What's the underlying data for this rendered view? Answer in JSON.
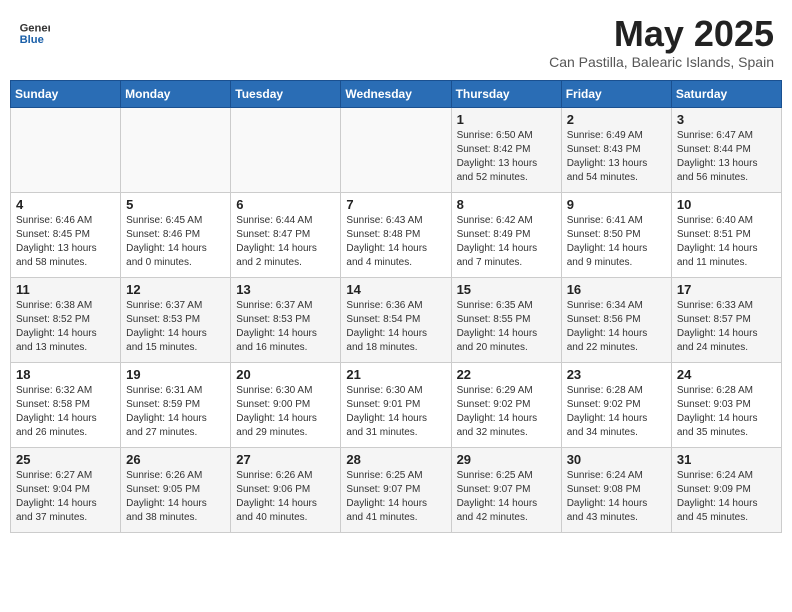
{
  "header": {
    "logo_general": "General",
    "logo_blue": "Blue",
    "month_title": "May 2025",
    "location": "Can Pastilla, Balearic Islands, Spain"
  },
  "days_of_week": [
    "Sunday",
    "Monday",
    "Tuesday",
    "Wednesday",
    "Thursday",
    "Friday",
    "Saturday"
  ],
  "weeks": [
    [
      {
        "num": "",
        "info": ""
      },
      {
        "num": "",
        "info": ""
      },
      {
        "num": "",
        "info": ""
      },
      {
        "num": "",
        "info": ""
      },
      {
        "num": "1",
        "info": "Sunrise: 6:50 AM\nSunset: 8:42 PM\nDaylight: 13 hours\nand 52 minutes."
      },
      {
        "num": "2",
        "info": "Sunrise: 6:49 AM\nSunset: 8:43 PM\nDaylight: 13 hours\nand 54 minutes."
      },
      {
        "num": "3",
        "info": "Sunrise: 6:47 AM\nSunset: 8:44 PM\nDaylight: 13 hours\nand 56 minutes."
      }
    ],
    [
      {
        "num": "4",
        "info": "Sunrise: 6:46 AM\nSunset: 8:45 PM\nDaylight: 13 hours\nand 58 minutes."
      },
      {
        "num": "5",
        "info": "Sunrise: 6:45 AM\nSunset: 8:46 PM\nDaylight: 14 hours\nand 0 minutes."
      },
      {
        "num": "6",
        "info": "Sunrise: 6:44 AM\nSunset: 8:47 PM\nDaylight: 14 hours\nand 2 minutes."
      },
      {
        "num": "7",
        "info": "Sunrise: 6:43 AM\nSunset: 8:48 PM\nDaylight: 14 hours\nand 4 minutes."
      },
      {
        "num": "8",
        "info": "Sunrise: 6:42 AM\nSunset: 8:49 PM\nDaylight: 14 hours\nand 7 minutes."
      },
      {
        "num": "9",
        "info": "Sunrise: 6:41 AM\nSunset: 8:50 PM\nDaylight: 14 hours\nand 9 minutes."
      },
      {
        "num": "10",
        "info": "Sunrise: 6:40 AM\nSunset: 8:51 PM\nDaylight: 14 hours\nand 11 minutes."
      }
    ],
    [
      {
        "num": "11",
        "info": "Sunrise: 6:38 AM\nSunset: 8:52 PM\nDaylight: 14 hours\nand 13 minutes."
      },
      {
        "num": "12",
        "info": "Sunrise: 6:37 AM\nSunset: 8:53 PM\nDaylight: 14 hours\nand 15 minutes."
      },
      {
        "num": "13",
        "info": "Sunrise: 6:37 AM\nSunset: 8:53 PM\nDaylight: 14 hours\nand 16 minutes."
      },
      {
        "num": "14",
        "info": "Sunrise: 6:36 AM\nSunset: 8:54 PM\nDaylight: 14 hours\nand 18 minutes."
      },
      {
        "num": "15",
        "info": "Sunrise: 6:35 AM\nSunset: 8:55 PM\nDaylight: 14 hours\nand 20 minutes."
      },
      {
        "num": "16",
        "info": "Sunrise: 6:34 AM\nSunset: 8:56 PM\nDaylight: 14 hours\nand 22 minutes."
      },
      {
        "num": "17",
        "info": "Sunrise: 6:33 AM\nSunset: 8:57 PM\nDaylight: 14 hours\nand 24 minutes."
      }
    ],
    [
      {
        "num": "18",
        "info": "Sunrise: 6:32 AM\nSunset: 8:58 PM\nDaylight: 14 hours\nand 26 minutes."
      },
      {
        "num": "19",
        "info": "Sunrise: 6:31 AM\nSunset: 8:59 PM\nDaylight: 14 hours\nand 27 minutes."
      },
      {
        "num": "20",
        "info": "Sunrise: 6:30 AM\nSunset: 9:00 PM\nDaylight: 14 hours\nand 29 minutes."
      },
      {
        "num": "21",
        "info": "Sunrise: 6:30 AM\nSunset: 9:01 PM\nDaylight: 14 hours\nand 31 minutes."
      },
      {
        "num": "22",
        "info": "Sunrise: 6:29 AM\nSunset: 9:02 PM\nDaylight: 14 hours\nand 32 minutes."
      },
      {
        "num": "23",
        "info": "Sunrise: 6:28 AM\nSunset: 9:02 PM\nDaylight: 14 hours\nand 34 minutes."
      },
      {
        "num": "24",
        "info": "Sunrise: 6:28 AM\nSunset: 9:03 PM\nDaylight: 14 hours\nand 35 minutes."
      }
    ],
    [
      {
        "num": "25",
        "info": "Sunrise: 6:27 AM\nSunset: 9:04 PM\nDaylight: 14 hours\nand 37 minutes."
      },
      {
        "num": "26",
        "info": "Sunrise: 6:26 AM\nSunset: 9:05 PM\nDaylight: 14 hours\nand 38 minutes."
      },
      {
        "num": "27",
        "info": "Sunrise: 6:26 AM\nSunset: 9:06 PM\nDaylight: 14 hours\nand 40 minutes."
      },
      {
        "num": "28",
        "info": "Sunrise: 6:25 AM\nSunset: 9:07 PM\nDaylight: 14 hours\nand 41 minutes."
      },
      {
        "num": "29",
        "info": "Sunrise: 6:25 AM\nSunset: 9:07 PM\nDaylight: 14 hours\nand 42 minutes."
      },
      {
        "num": "30",
        "info": "Sunrise: 6:24 AM\nSunset: 9:08 PM\nDaylight: 14 hours\nand 43 minutes."
      },
      {
        "num": "31",
        "info": "Sunrise: 6:24 AM\nSunset: 9:09 PM\nDaylight: 14 hours\nand 45 minutes."
      }
    ]
  ]
}
